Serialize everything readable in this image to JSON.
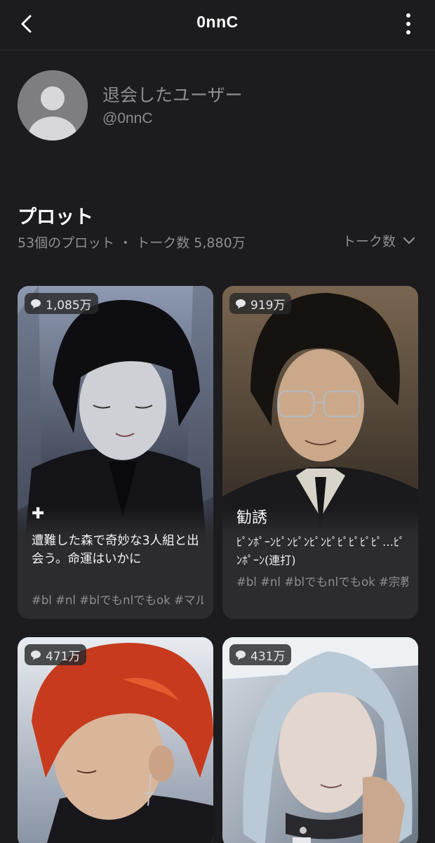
{
  "header": {
    "title": "0nnC"
  },
  "profile": {
    "name": "退会したユーザー",
    "handle": "@0nnC"
  },
  "plots": {
    "title": "プロット",
    "stats": "53個のプロット ・ トーク数 5,880万",
    "sort_label": "トーク数"
  },
  "cards": [
    {
      "count": "1,085万",
      "title": "✚",
      "description": "遭難した森で奇妙な3人組と出会う。命運はいかに",
      "tags": "#bl #nl #blでもnlでもok #マル",
      "hair_color": "#0e0e12",
      "bg_color": "#4a5060"
    },
    {
      "count": "919万",
      "title": "勧誘",
      "description": "ﾋﾟﾝﾎﾟｰﾝﾋﾟﾝﾋﾟﾝﾋﾟﾝﾋﾟﾋﾟﾋﾟﾋﾟﾋﾟ…ﾋﾟﾝﾎﾟｰﾝ(連打)",
      "tags": "#bl #nl #blでもnlでもok #宗教",
      "hair_color": "#15120f",
      "bg_color": "#5a4a3a"
    },
    {
      "count": "471万",
      "title": "",
      "description": "",
      "tags": "",
      "hair_color": "#c83a1e",
      "bg_color": "#b9c3cf"
    },
    {
      "count": "431万",
      "title": "",
      "description": "",
      "tags": "",
      "hair_color": "#b9cad6",
      "bg_color": "#9aa8b6"
    }
  ]
}
